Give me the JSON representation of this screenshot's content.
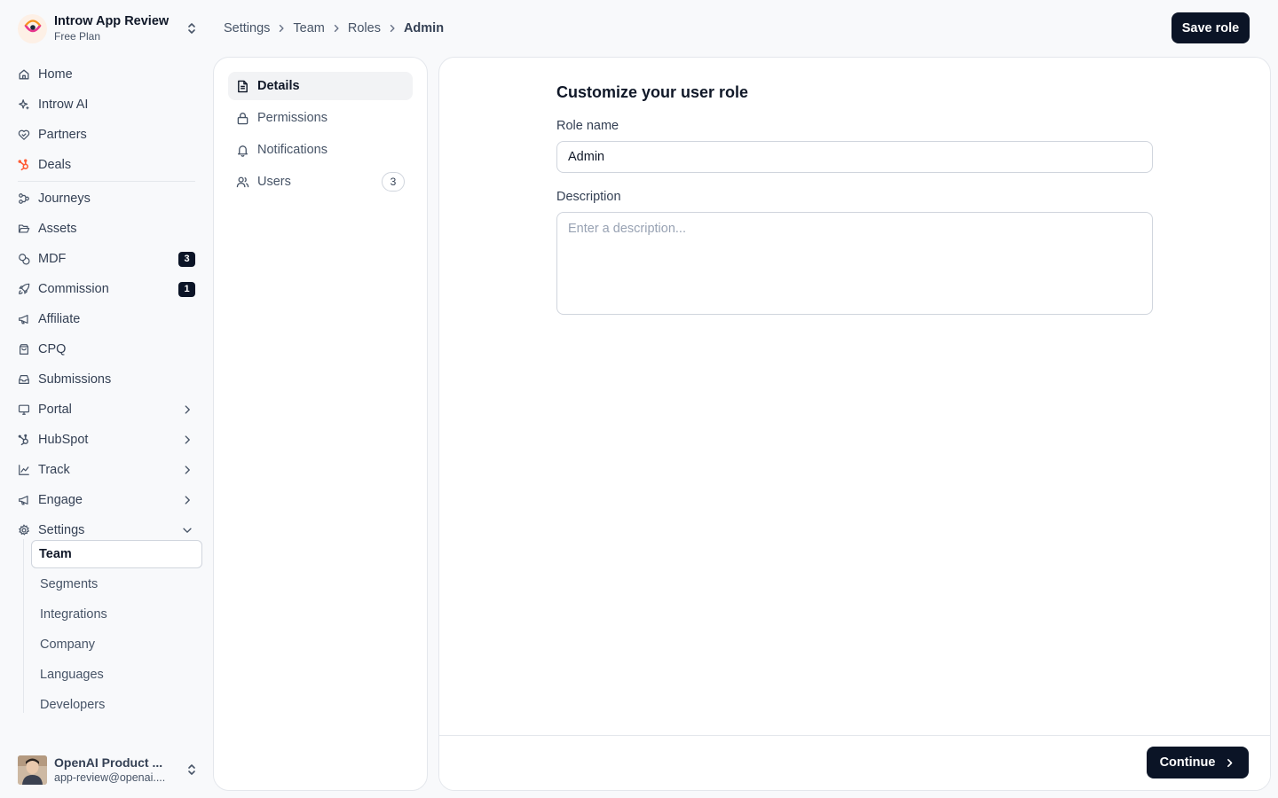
{
  "workspace": {
    "name": "Introw App Review",
    "plan": "Free Plan"
  },
  "nav": {
    "home": "Home",
    "introw_ai": "Introw AI",
    "partners": "Partners",
    "deals": "Deals",
    "journeys": "Journeys",
    "assets": "Assets",
    "mdf": "MDF",
    "mdf_count": "3",
    "commission": "Commission",
    "commission_count": "1",
    "affiliate": "Affiliate",
    "cpq": "CPQ",
    "submissions": "Submissions",
    "portal": "Portal",
    "hubspot": "HubSpot",
    "track": "Track",
    "engage": "Engage",
    "settings": "Settings",
    "settings_children": [
      "Team",
      "Segments",
      "Integrations",
      "Company",
      "Languages",
      "Developers"
    ],
    "active_child": "Team"
  },
  "user": {
    "name": "OpenAI Product ...",
    "email": "app-review@openai...."
  },
  "breadcrumb": [
    "Settings",
    "Team",
    "Roles",
    "Admin"
  ],
  "header": {
    "save_label": "Save role"
  },
  "role_tabs": {
    "details": "Details",
    "permissions": "Permissions",
    "notifications": "Notifications",
    "users": "Users",
    "users_count": "3",
    "active": "Details"
  },
  "form": {
    "title": "Customize your user role",
    "role_name_label": "Role name",
    "role_name_value": "Admin",
    "description_label": "Description",
    "description_placeholder": "Enter a description..."
  },
  "footer": {
    "continue_label": "Continue"
  },
  "colors": {
    "primary_button": "#0b1426",
    "background": "#f8f9fb",
    "border": "#e4e7ec",
    "hubspot_orange": "#ff5c35",
    "logo_pink": "#e8368f",
    "logo_orange": "#f7931e"
  }
}
